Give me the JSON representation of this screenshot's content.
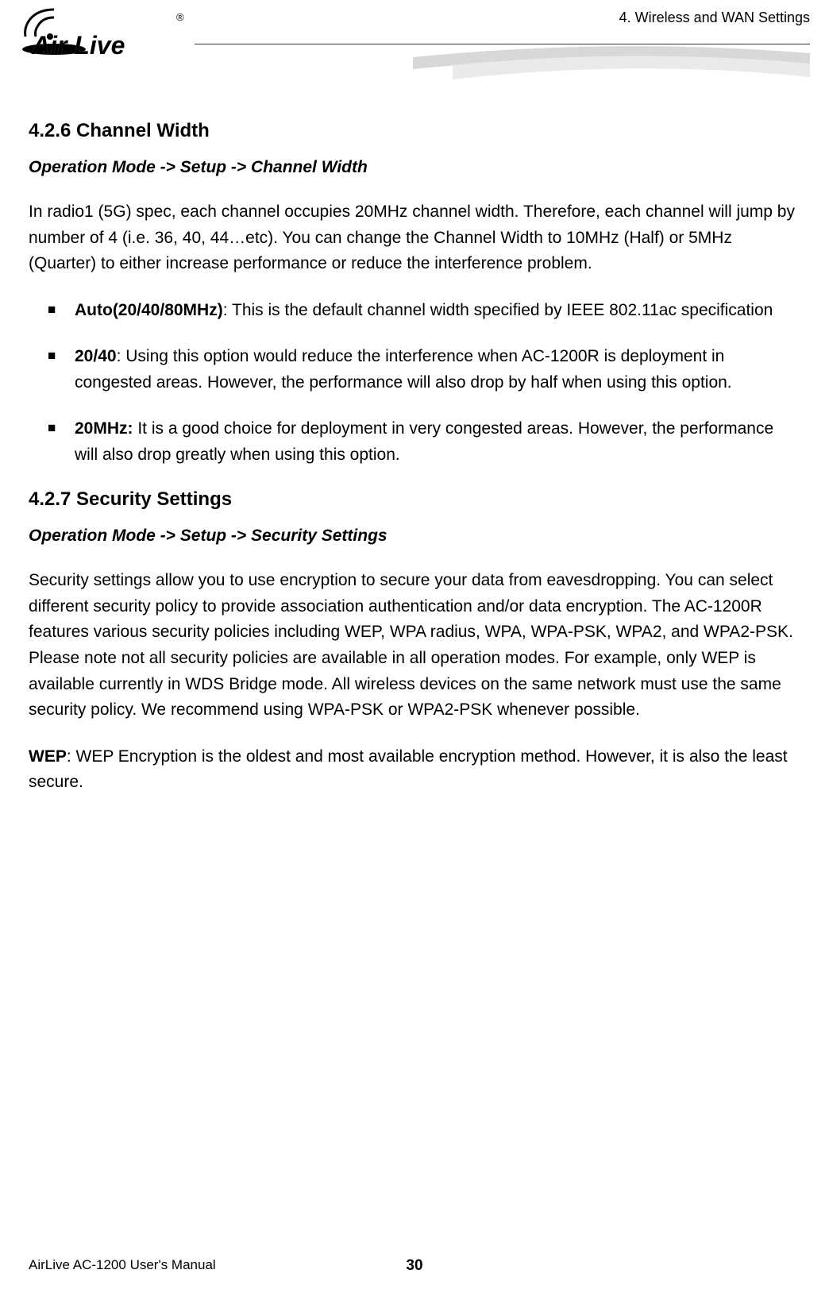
{
  "header": {
    "chapterTitle": "4. Wireless and WAN Settings",
    "logoText": "Air Live"
  },
  "section1": {
    "heading": "4.2.6 Channel Width",
    "breadcrumb": "Operation Mode -> Setup -> Channel Width",
    "intro": "In radio1 (5G) spec, each channel occupies 20MHz channel width. Therefore, each channel will jump by number of 4 (i.e. 36, 40, 44…etc). You can change the Channel Width to 10MHz (Half) or 5MHz (Quarter) to either increase performance or reduce the interference problem.",
    "bullets": [
      {
        "label": "Auto(20/40/80MHz)",
        "text": ": This is the default channel width specified by IEEE 802.11ac specification"
      },
      {
        "label": "20/40",
        "text": ": Using this option would reduce the interference when AC-1200R is deployment in congested areas. However, the performance will also drop by half when using this option."
      },
      {
        "label": "20MHz:",
        "text": " It is a good choice for deployment in very congested areas. However, the performance will also drop greatly when using this option."
      }
    ]
  },
  "section2": {
    "heading": "4.2.7 Security Settings",
    "breadcrumb": "Operation Mode -> Setup -> Security Settings",
    "para1": "Security settings allow you to use encryption to secure your data from eavesdropping. You can select different security policy to provide association authentication and/or data encryption. The AC-1200R features various security policies including WEP, WPA radius, WPA, WPA-PSK, WPA2, and WPA2-PSK. Please note not all security policies are available in all operation modes. For example, only WEP is available currently in WDS Bridge mode. All wireless devices on the same network must use the same security policy. We recommend using WPA-PSK or WPA2-PSK whenever possible.",
    "wep": {
      "label": "WEP",
      "text": ": WEP Encryption is the oldest and most available encryption method. However, it is also the least secure."
    }
  },
  "footer": {
    "manualName": "AirLive AC-1200 User's Manual",
    "pageNumber": "30"
  }
}
